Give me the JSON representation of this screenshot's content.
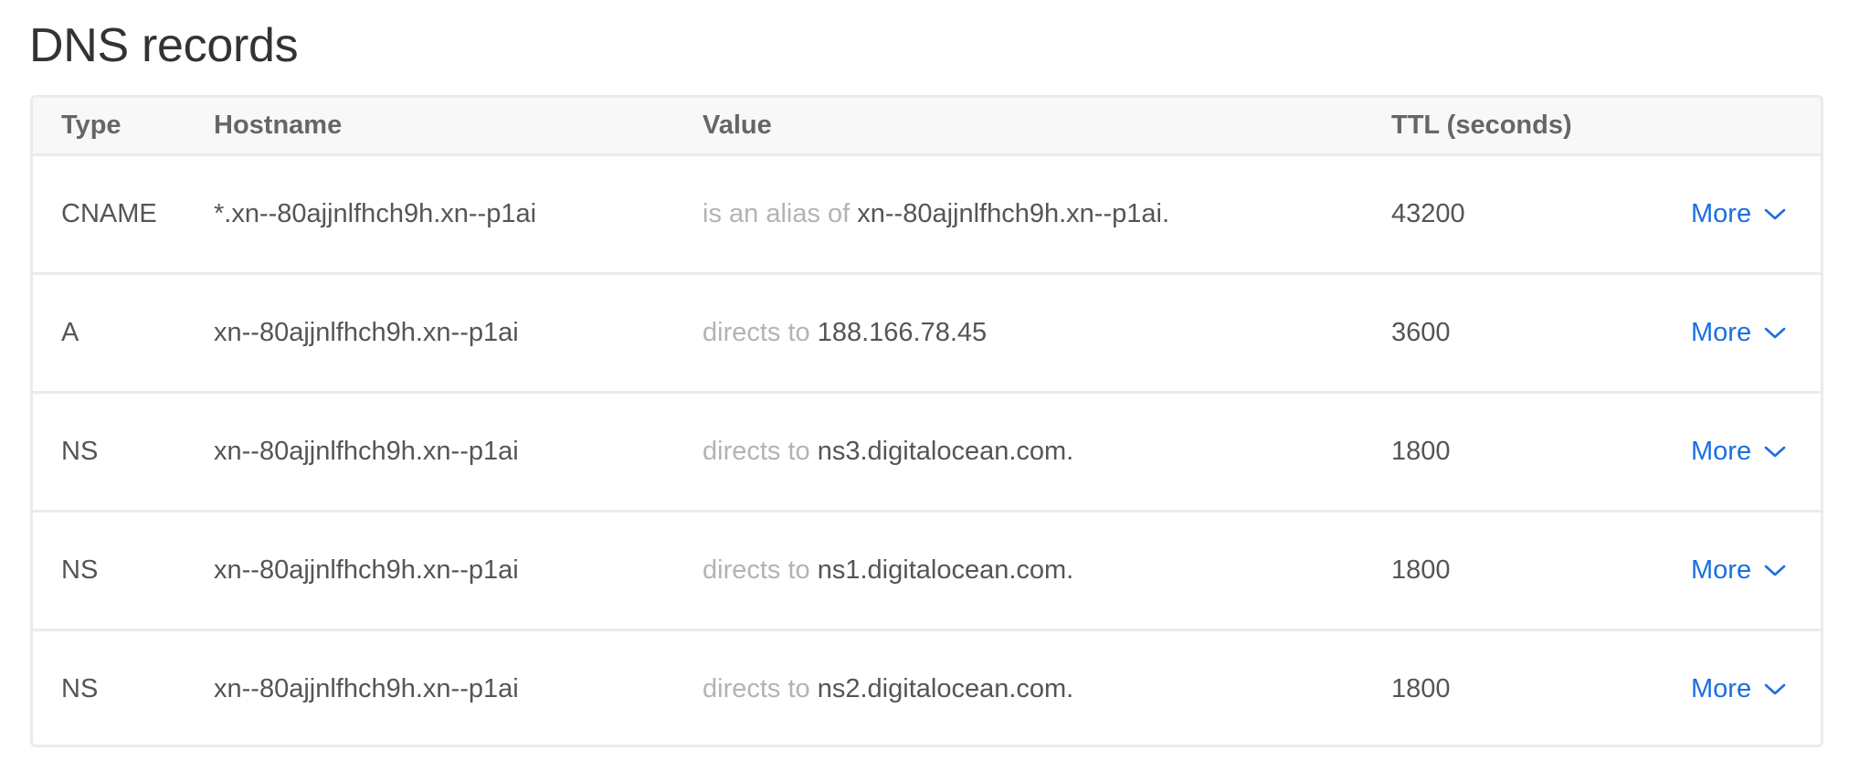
{
  "page": {
    "title": "DNS records"
  },
  "table": {
    "columns": {
      "type": "Type",
      "hostname": "Hostname",
      "value": "Value",
      "ttl": "TTL (seconds)"
    },
    "rows": [
      {
        "type": "CNAME",
        "hostname": "*.xn--80ajjnlfhch9h.xn--p1ai",
        "value_prefix": "is an alias of",
        "value_target": "xn--80ajjnlfhch9h.xn--p1ai.",
        "ttl": "43200",
        "more_label": "More"
      },
      {
        "type": "A",
        "hostname": "xn--80ajjnlfhch9h.xn--p1ai",
        "value_prefix": "directs to",
        "value_target": "188.166.78.45",
        "ttl": "3600",
        "more_label": "More"
      },
      {
        "type": "NS",
        "hostname": "xn--80ajjnlfhch9h.xn--p1ai",
        "value_prefix": "directs to",
        "value_target": "ns3.digitalocean.com.",
        "ttl": "1800",
        "more_label": "More"
      },
      {
        "type": "NS",
        "hostname": "xn--80ajjnlfhch9h.xn--p1ai",
        "value_prefix": "directs to",
        "value_target": "ns1.digitalocean.com.",
        "ttl": "1800",
        "more_label": "More"
      },
      {
        "type": "NS",
        "hostname": "xn--80ajjnlfhch9h.xn--p1ai",
        "value_prefix": "directs to",
        "value_target": "ns2.digitalocean.com.",
        "ttl": "1800",
        "more_label": "More"
      }
    ]
  },
  "icons": {
    "more": "chevron-down-icon"
  },
  "colors": {
    "link": "#1a6fe0",
    "muted_text": "#b3b3b3",
    "text": "#555555",
    "header_bg": "#f8f8f8",
    "border": "#ebebeb"
  }
}
